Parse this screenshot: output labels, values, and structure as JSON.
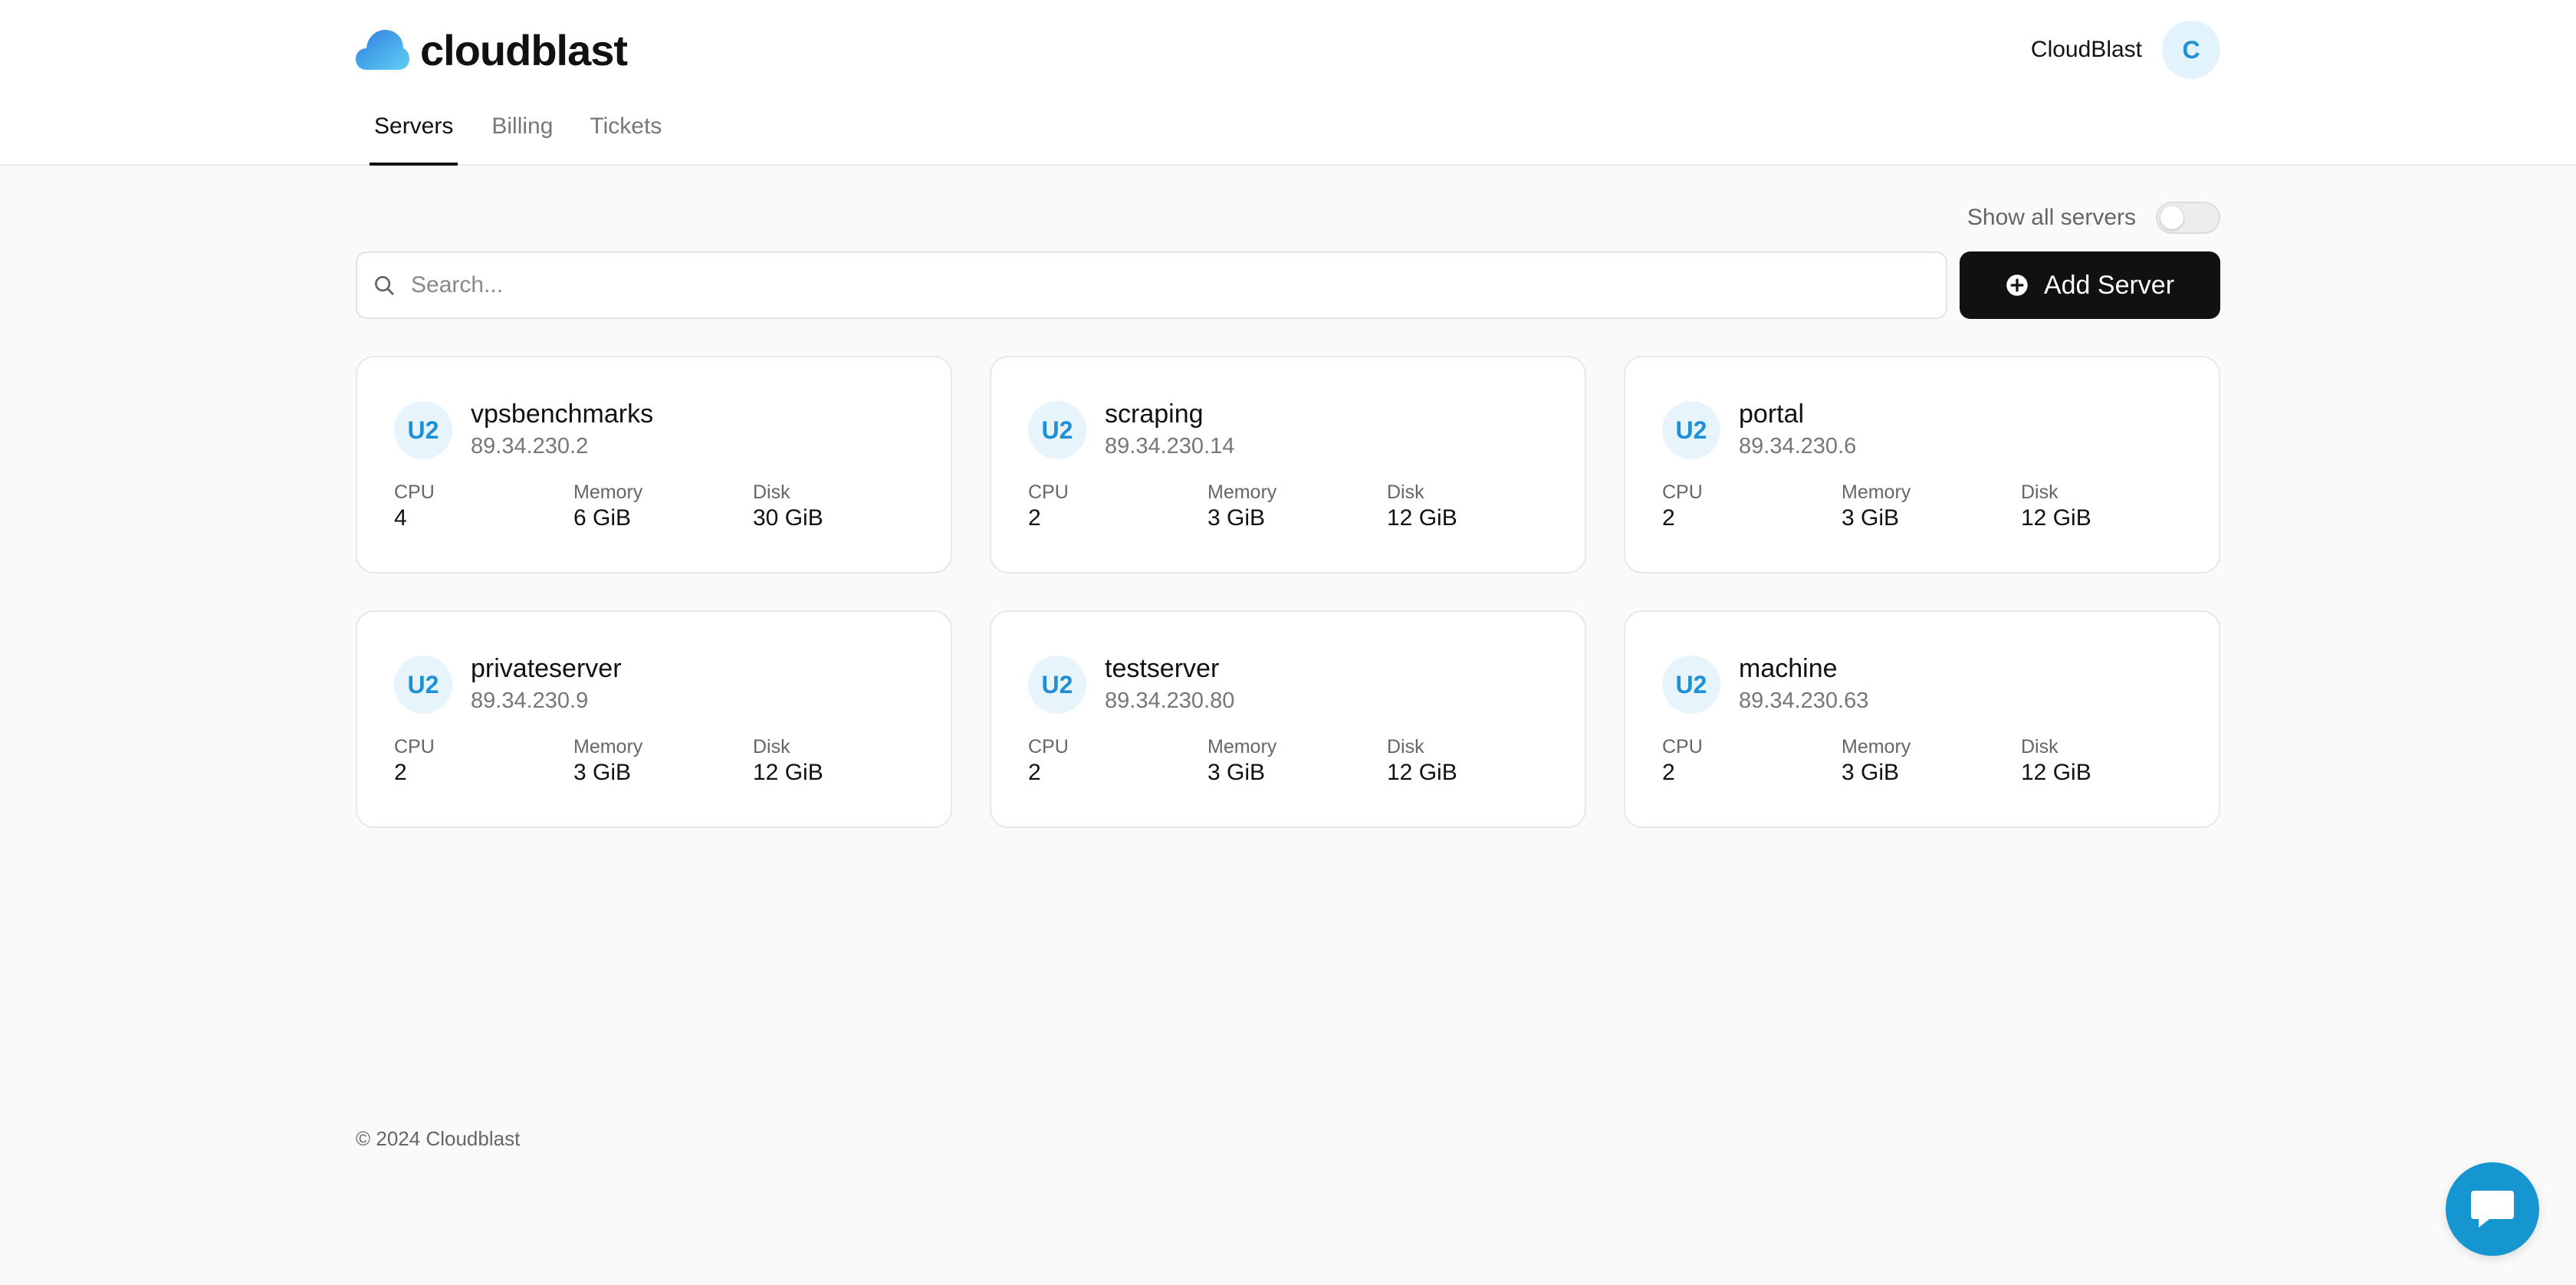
{
  "brand": {
    "name": "cloudblast"
  },
  "user": {
    "name": "CloudBlast",
    "initial": "C"
  },
  "nav": {
    "tabs": [
      {
        "label": "Servers",
        "active": true
      },
      {
        "label": "Billing",
        "active": false
      },
      {
        "label": "Tickets",
        "active": false
      }
    ]
  },
  "filters": {
    "show_all_label": "Show all servers",
    "show_all_on": false
  },
  "search": {
    "placeholder": "Search...",
    "value": ""
  },
  "actions": {
    "add_server_label": "Add Server"
  },
  "spec_labels": {
    "cpu": "CPU",
    "memory": "Memory",
    "disk": "Disk"
  },
  "servers": [
    {
      "badge": "U2",
      "name": "vpsbenchmarks",
      "ip": "89.34.230.2",
      "cpu": "4",
      "memory": "6 GiB",
      "disk": "30 GiB"
    },
    {
      "badge": "U2",
      "name": "scraping",
      "ip": "89.34.230.14",
      "cpu": "2",
      "memory": "3 GiB",
      "disk": "12 GiB"
    },
    {
      "badge": "U2",
      "name": "portal",
      "ip": "89.34.230.6",
      "cpu": "2",
      "memory": "3 GiB",
      "disk": "12 GiB"
    },
    {
      "badge": "U2",
      "name": "privateserver",
      "ip": "89.34.230.9",
      "cpu": "2",
      "memory": "3 GiB",
      "disk": "12 GiB"
    },
    {
      "badge": "U2",
      "name": "testserver",
      "ip": "89.34.230.80",
      "cpu": "2",
      "memory": "3 GiB",
      "disk": "12 GiB"
    },
    {
      "badge": "U2",
      "name": "machine",
      "ip": "89.34.230.63",
      "cpu": "2",
      "memory": "3 GiB",
      "disk": "12 GiB"
    }
  ],
  "footer": {
    "copyright": "© 2024 Cloudblast"
  },
  "colors": {
    "accent": "#1f8fd6",
    "primary_button": "#111114",
    "chat": "#1596d1"
  },
  "icons": {
    "logo": "cloud-icon",
    "search": "search-icon",
    "add": "plus-circle-icon",
    "chat": "chat-bubble-icon"
  }
}
